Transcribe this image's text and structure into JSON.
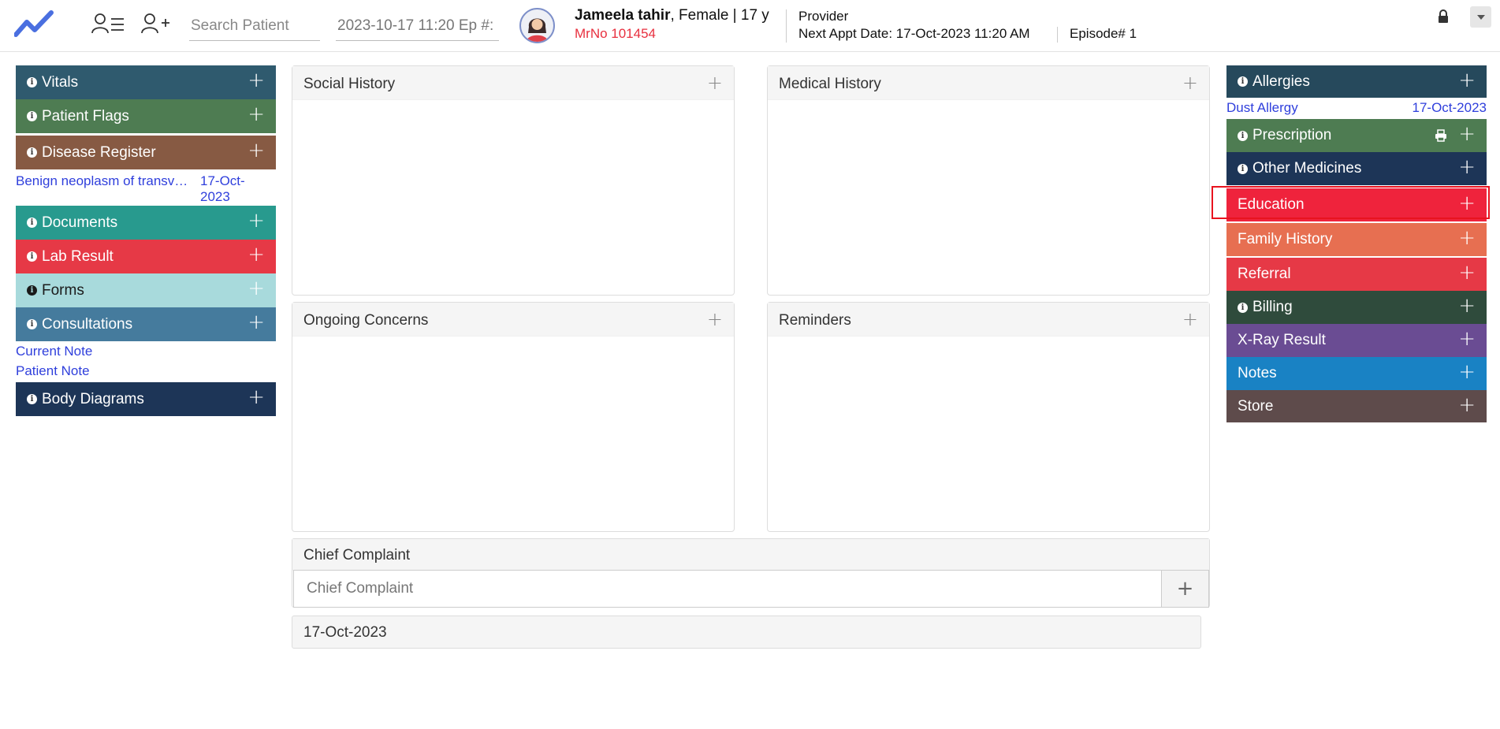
{
  "header": {
    "search_placeholder": "Search Patient",
    "episode_field": "2023-10-17 11:20 Ep #:",
    "patient_name": "Jameela tahir",
    "patient_info": ", Female | 17 y",
    "mrno": "MrNo 101454",
    "provider_label": "Provider",
    "next_appt_label": "Next Appt Date",
    "next_appt_value": ": 17-Oct-2023 11:20 AM",
    "episode": "Episode# 1"
  },
  "left_panels": [
    {
      "label": "Vitals",
      "color": "#2f5a6e"
    },
    {
      "label": "Patient Flags",
      "color": "#4e7c52"
    },
    {
      "label": "Disease Register",
      "color": "#875a43",
      "entry": {
        "text": "Benign neoplasm of transv…",
        "date_line1": "17-Oct-",
        "date_line2": "2023"
      }
    },
    {
      "label": "Documents",
      "color": "#289a8e"
    },
    {
      "label": "Lab Result",
      "color": "#e63946"
    },
    {
      "label": "Forms",
      "color": "#a8dadc"
    },
    {
      "label": "Consultations",
      "color": "#457b9d",
      "links": [
        "Current Note",
        "Patient Note"
      ]
    },
    {
      "label": "Body Diagrams",
      "color": "#1d3557"
    }
  ],
  "center": {
    "social_history": "Social History",
    "medical_history": "Medical History",
    "ongoing_concerns": "Ongoing Concerns",
    "reminders": "Reminders",
    "chief_complaint_title": "Chief Complaint",
    "chief_complaint_placeholder": "Chief Complaint",
    "date_row": "17-Oct-2023"
  },
  "right_panels": [
    {
      "label": "Allergies",
      "color": "#26495c",
      "entry": {
        "text": "Dust Allergy",
        "date": "17-Oct-2023"
      }
    },
    {
      "label": "Prescription",
      "color": "#4e7c52"
    },
    {
      "label": "Other Medicines",
      "color": "#1d3557"
    },
    {
      "label": "Education",
      "color": "#ef233c"
    },
    {
      "label": "Family History",
      "color": "#e76f51"
    },
    {
      "label": "Referral",
      "color": "#e63946"
    },
    {
      "label": "Billing",
      "color": "#2f4b3c"
    },
    {
      "label": "X-Ray Result",
      "color": "#6a4c93"
    },
    {
      "label": "Notes",
      "color": "#1982c4"
    },
    {
      "label": "Store",
      "color": "#5e4b4b"
    }
  ],
  "icons": {
    "logo": "trend-line-logo-icon",
    "patient_list": "patient-list-icon",
    "add_patient": "add-patient-icon",
    "info": "info-icon",
    "plus": "plus-icon",
    "print": "print-icon",
    "lock": "lock-icon",
    "dropdown": "caret-down-icon"
  }
}
